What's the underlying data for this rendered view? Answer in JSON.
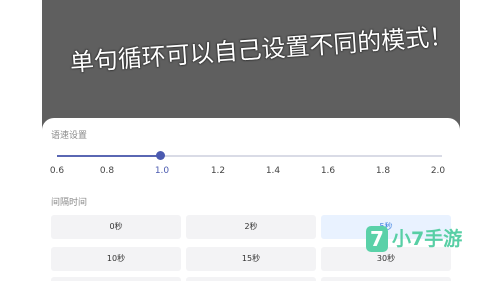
{
  "caption": "单句循环可以自己设置不同的模式！",
  "speed_section": {
    "label": "语速设置",
    "ticks": [
      "0.6",
      "0.8",
      "1.0",
      "1.2",
      "1.4",
      "1.6",
      "1.8",
      "2.0"
    ],
    "selected_value": 1.0
  },
  "interval_section": {
    "label": "间隔时间",
    "options": [
      "0秒",
      "2秒",
      "5秒",
      "10秒",
      "15秒",
      "30秒"
    ],
    "selected_option": "5秒"
  },
  "watermark": {
    "icon_glyph": "7",
    "text": "小7手游"
  },
  "colors": {
    "accent": "#4b5ab0",
    "video_bg": "#5f5f5f",
    "watermark": "#58cfa5"
  }
}
